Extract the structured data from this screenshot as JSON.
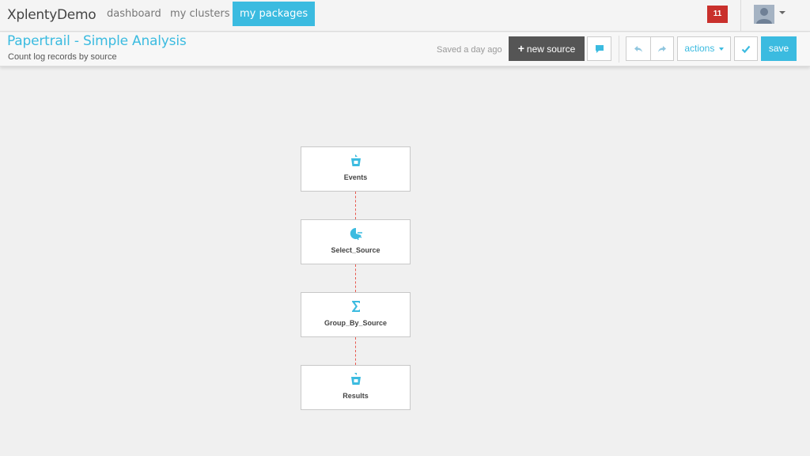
{
  "nav": {
    "brand": "XplentyDemo",
    "links": [
      {
        "label": "dashboard",
        "active": false
      },
      {
        "label": "my clusters",
        "active": false
      },
      {
        "label": "my packages",
        "active": true
      }
    ],
    "notification_count": "11"
  },
  "package": {
    "title": "Papertrail - Simple Analysis",
    "subtitle": "Count log records by source",
    "saved_status": "Saved a day ago"
  },
  "toolbar": {
    "new_source_label": "new source",
    "actions_label": "actions",
    "save_label": "save"
  },
  "pipeline": {
    "nodes": [
      {
        "label": "Events",
        "icon": "source-bucket-icon"
      },
      {
        "label": "Select_Source",
        "icon": "select-filter-icon"
      },
      {
        "label": "Group_By_Source",
        "icon": "sigma-icon"
      },
      {
        "label": "Results",
        "icon": "destination-bucket-icon"
      }
    ],
    "connector_color": "#e85a4f"
  },
  "colors": {
    "accent": "#3bbbe0",
    "badge": "#c9302c",
    "dark_button": "#555555"
  }
}
